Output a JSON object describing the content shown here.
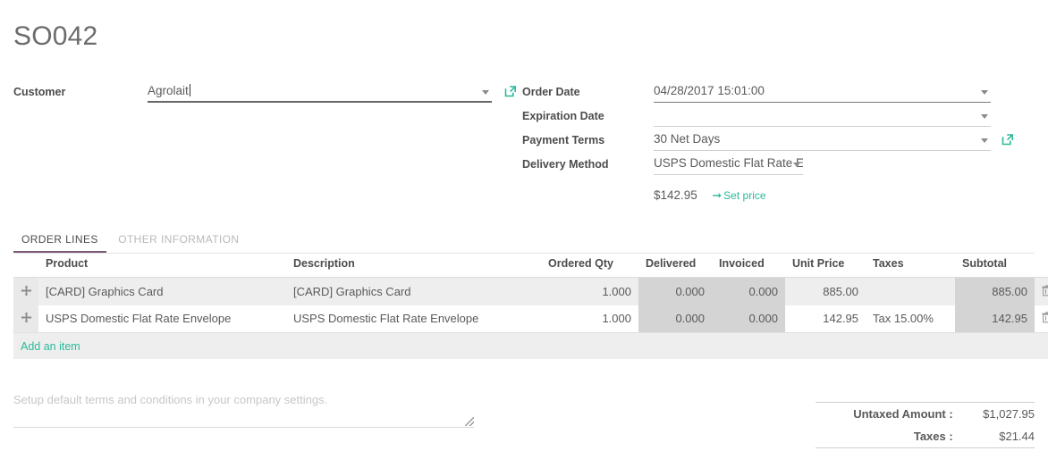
{
  "document": {
    "title": "SO042"
  },
  "colors": {
    "accent_teal": "#2bb99a",
    "tab_underline": "#7c5a77",
    "label_gray": "#4c4c4c",
    "value_gray": "#5a5a5a",
    "row_shade": "#eeeeee",
    "readonly_shade": "#d4d4d4"
  },
  "form": {
    "left": [
      {
        "label": "Customer",
        "value": "Agrolait",
        "has_dropdown": true,
        "has_external_link": true,
        "focused": true
      }
    ],
    "right": [
      {
        "label": "Order Date",
        "value": "04/28/2017 15:01:00",
        "has_dropdown": true,
        "has_external_link": false
      },
      {
        "label": "Expiration Date",
        "value": "",
        "has_dropdown": true,
        "has_external_link": false
      },
      {
        "label": "Payment Terms",
        "value": "30 Net Days",
        "has_dropdown": true,
        "has_external_link": true
      },
      {
        "label": "Delivery Method",
        "value": "USPS Domestic Flat Rate Envelope",
        "has_dropdown": true,
        "has_external_link": false
      }
    ],
    "delivery_price": {
      "amount": "$142.95",
      "action_label": "Set price",
      "action_icon": "arrow-right-icon"
    }
  },
  "tabs": [
    {
      "label": "ORDER LINES",
      "active": true
    },
    {
      "label": "OTHER INFORMATION",
      "active": false
    }
  ],
  "order_lines": {
    "columns": [
      {
        "key": "product",
        "label": "Product",
        "align": "left"
      },
      {
        "key": "description",
        "label": "Description",
        "align": "left"
      },
      {
        "key": "ordered_qty",
        "label": "Ordered Qty",
        "align": "right"
      },
      {
        "key": "delivered",
        "label": "Delivered",
        "align": "right"
      },
      {
        "key": "invoiced",
        "label": "Invoiced",
        "align": "right"
      },
      {
        "key": "unit_price",
        "label": "Unit Price",
        "align": "right"
      },
      {
        "key": "taxes",
        "label": "Taxes",
        "align": "left"
      },
      {
        "key": "subtotal",
        "label": "Subtotal",
        "align": "right"
      }
    ],
    "rows": [
      {
        "product": "[CARD] Graphics Card",
        "description": "[CARD] Graphics Card",
        "ordered_qty": "1.000",
        "delivered": "0.000",
        "invoiced": "0.000",
        "unit_price": "885.00",
        "taxes": "",
        "subtotal": "885.00"
      },
      {
        "product": "USPS Domestic Flat Rate Envelope",
        "description": "USPS Domestic Flat Rate Envelope",
        "ordered_qty": "1.000",
        "delivered": "0.000",
        "invoiced": "0.000",
        "unit_price": "142.95",
        "taxes": "Tax 15.00%",
        "subtotal": "142.95"
      }
    ],
    "add_item_label": "Add an item",
    "row_icons": {
      "drag": "move-icon",
      "delete": "trash-icon"
    }
  },
  "notes": {
    "placeholder": "Setup default terms and conditions in your company settings.",
    "value": ""
  },
  "totals": [
    {
      "label": "Untaxed Amount :",
      "value": "$1,027.95"
    },
    {
      "label": "Taxes :",
      "value": "$21.44"
    }
  ]
}
